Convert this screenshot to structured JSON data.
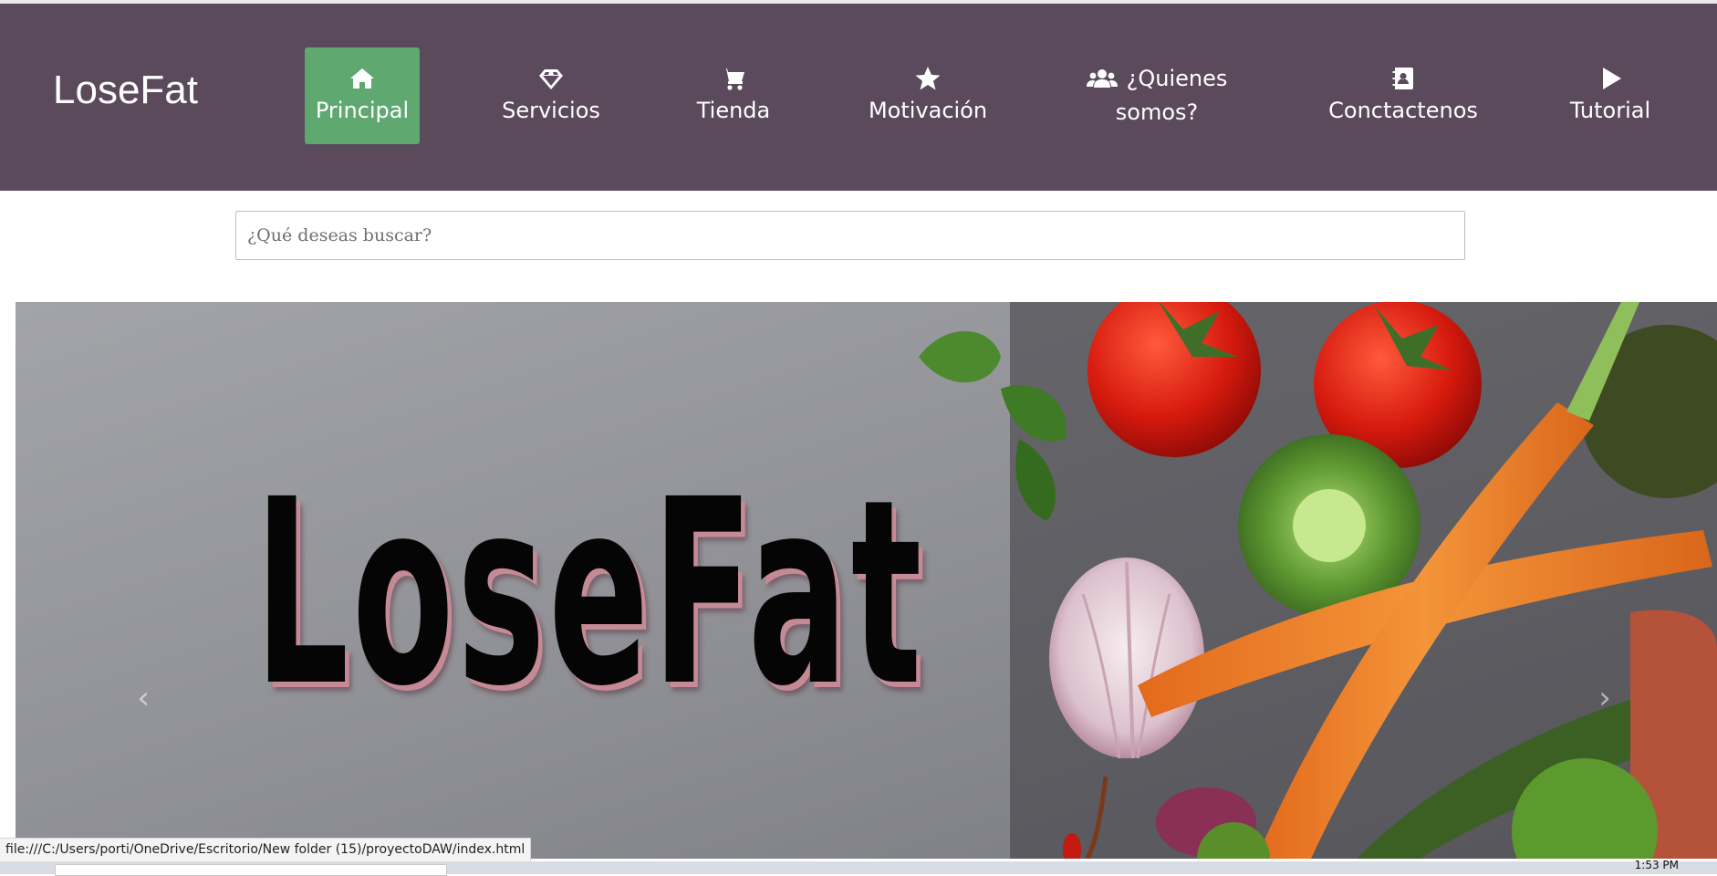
{
  "brand": "LoseFat",
  "nav": [
    {
      "label": "Principal",
      "icon": "home-icon",
      "active": true
    },
    {
      "label": "Servicios",
      "icon": "diamond-icon",
      "active": false
    },
    {
      "label": "Tienda",
      "icon": "shopping-cart-icon",
      "active": false
    },
    {
      "label": "Motivación",
      "icon": "star-icon",
      "active": false
    },
    {
      "label_line1": "¿Quienes",
      "label_line2": "somos?",
      "icon": "users-icon",
      "active": false
    },
    {
      "label": "Conctactenos",
      "icon": "address-book-icon",
      "active": false
    },
    {
      "label": "Tutorial",
      "icon": "play-icon",
      "active": false
    }
  ],
  "search": {
    "placeholder": "¿Qué deseas buscar?",
    "value": ""
  },
  "hero": {
    "title": "LoseFat",
    "prev_glyph": "‹",
    "next_glyph": "›"
  },
  "status_bar": {
    "url": "file:///C:/Users/porti/OneDrive/Escritorio/New folder (15)/proyectoDAW/index.html"
  },
  "taskbar": {
    "clock": "1:53 PM"
  },
  "colors": {
    "navbar": "#5a4a5c",
    "active_nav": "#5fa870"
  }
}
